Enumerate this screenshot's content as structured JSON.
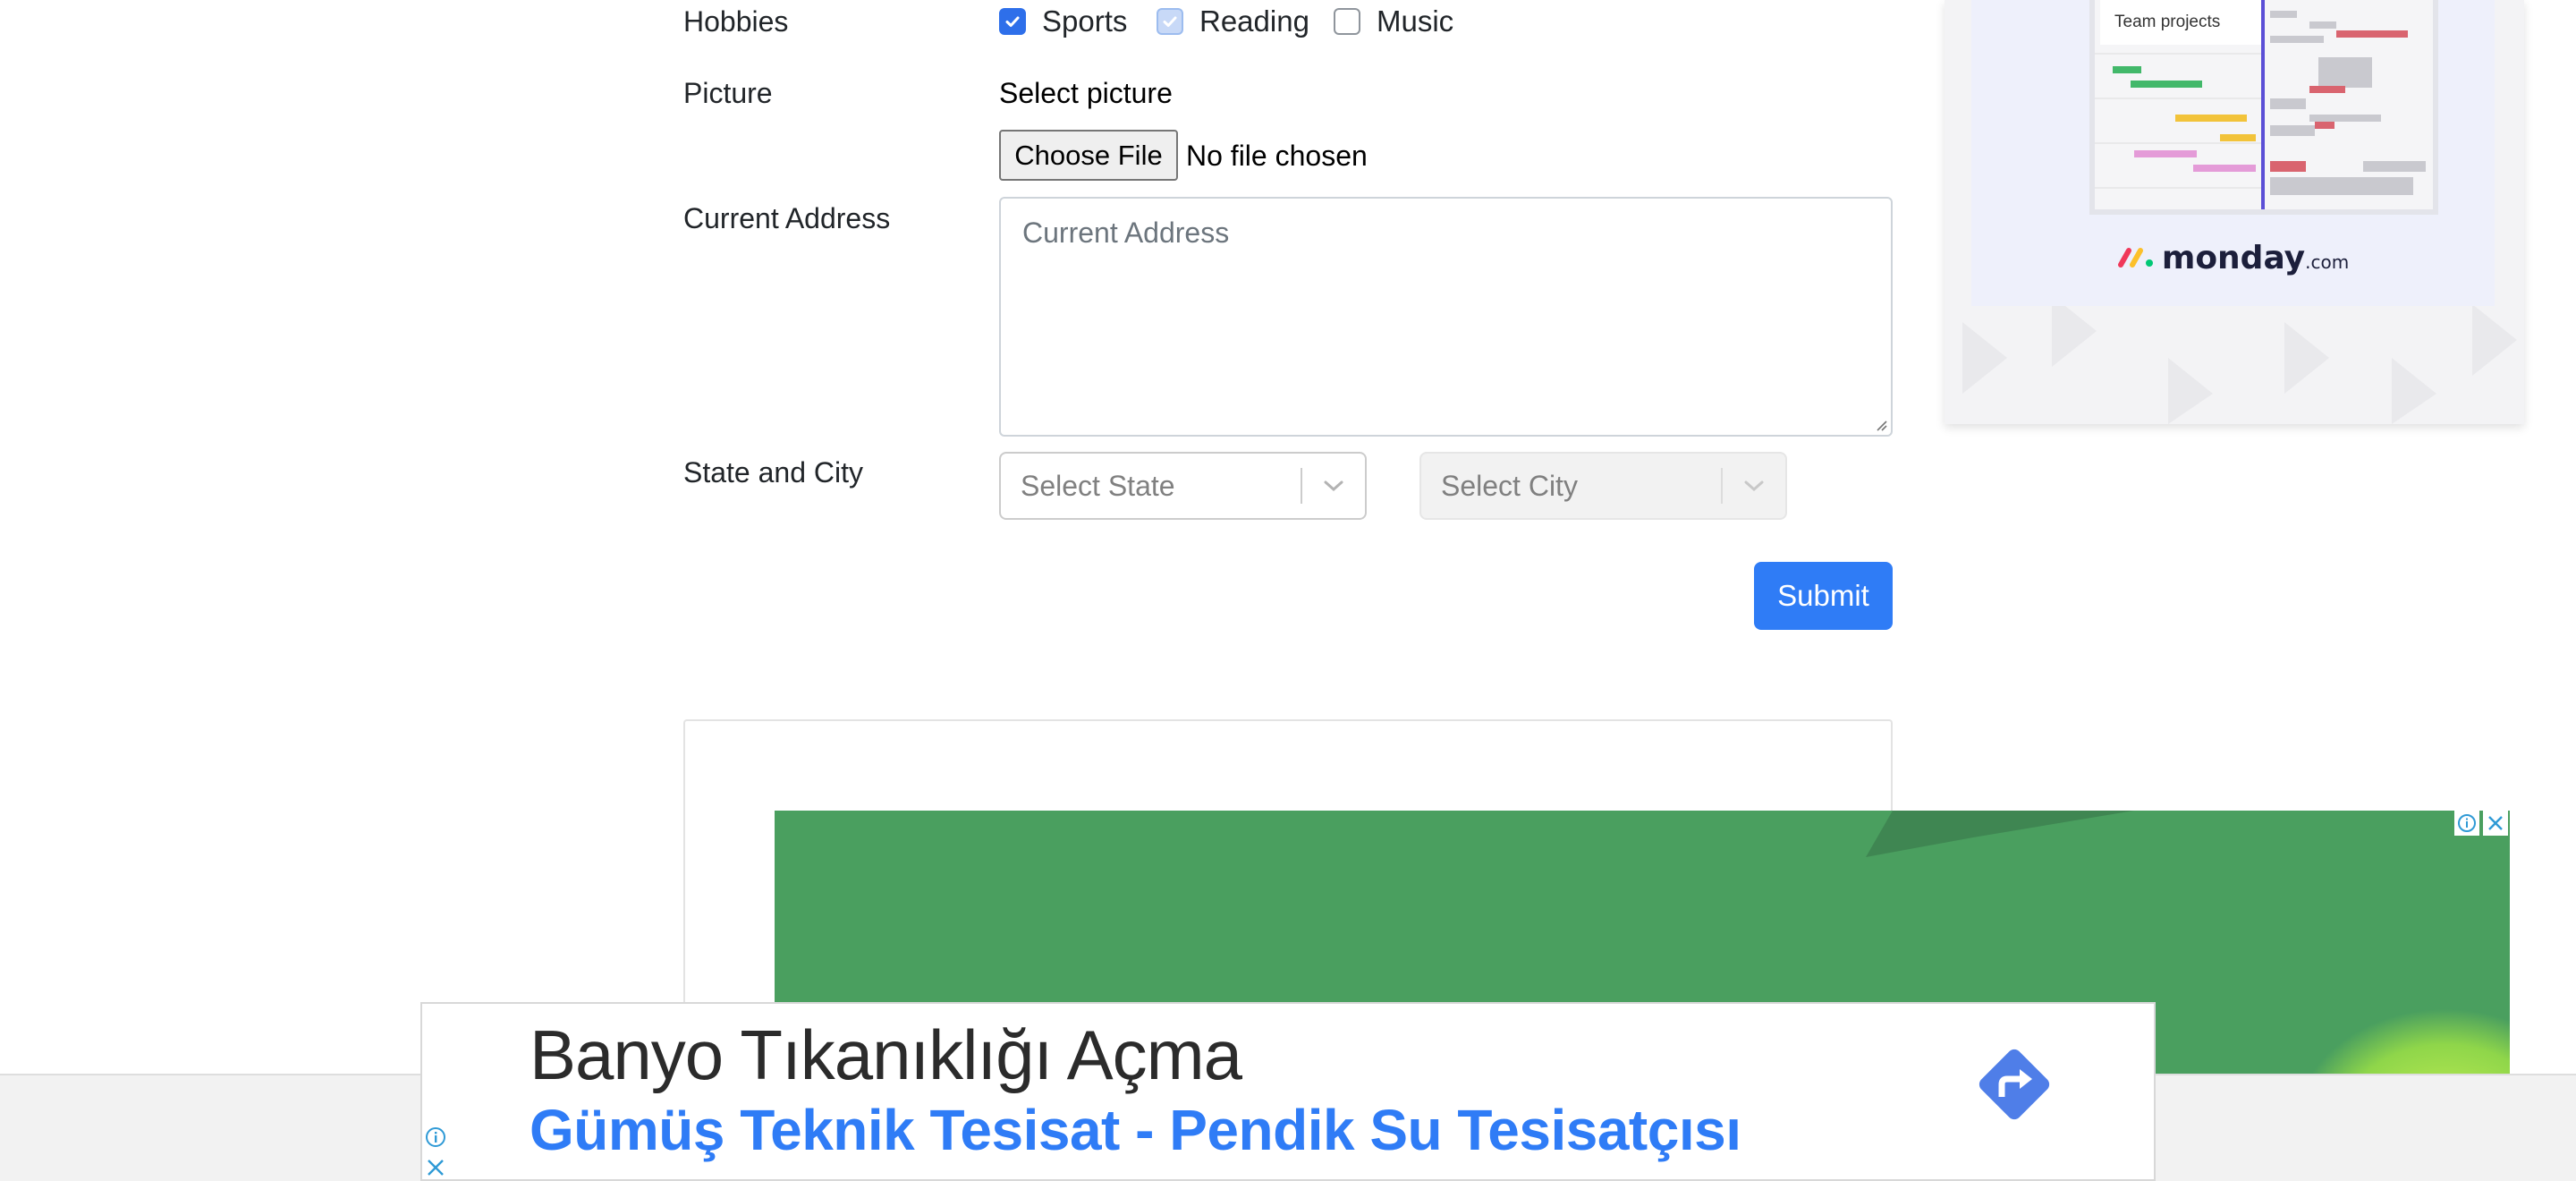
{
  "form": {
    "hobbies": {
      "label": "Hobbies",
      "options": [
        {
          "label": "Sports",
          "checked": true
        },
        {
          "label": "Reading",
          "checked": true
        },
        {
          "label": "Music",
          "checked": false
        }
      ]
    },
    "picture": {
      "label": "Picture",
      "caption": "Select picture",
      "button_label": "Choose File",
      "status": "No file chosen"
    },
    "current_address": {
      "label": "Current Address",
      "placeholder": "Current Address"
    },
    "state_city": {
      "label": "State and City",
      "state_placeholder": "Select State",
      "city_placeholder": "Select City"
    },
    "submit_label": "Submit"
  },
  "ads": {
    "right": {
      "tab_label": "Team projects",
      "brand": "monday",
      "brand_suffix": ".com"
    },
    "bottom": {
      "headline": "Banyo Tıkanıklığı Açma",
      "subline": "Gümüş Teknik Tesisat - Pendik Su Tesisatçısı"
    }
  },
  "colors": {
    "primary": "#2f7cf6",
    "ad_green": "#4a9f5f",
    "text": "#212529",
    "muted": "#6c757d"
  }
}
